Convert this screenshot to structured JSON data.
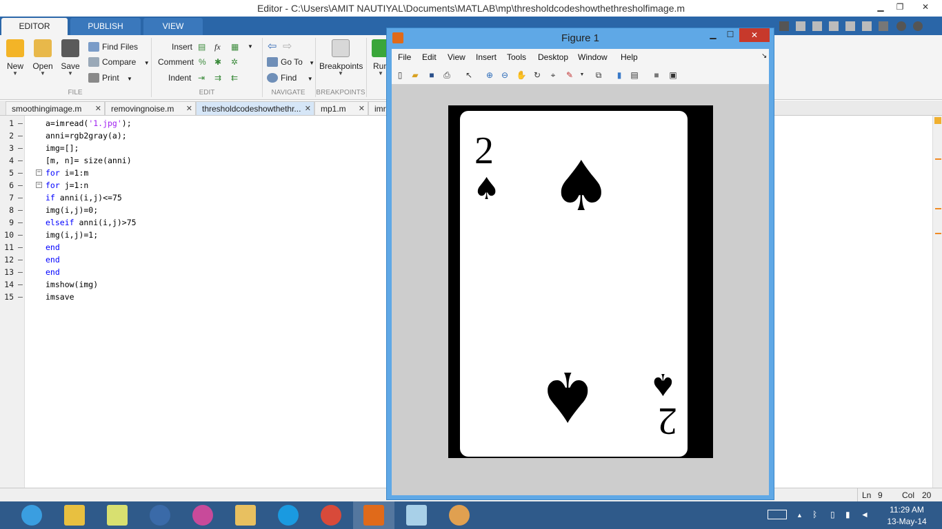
{
  "window": {
    "title": "Editor - C:\\Users\\AMIT NAUTIYAL\\Documents\\MATLAB\\mp\\thresholdcodeshowthethresholfimage.m",
    "min_glyph": "▁",
    "max_glyph": "❐",
    "close_glyph": "✕"
  },
  "ribbon": {
    "tabs": [
      "EDITOR",
      "PUBLISH",
      "VIEW"
    ],
    "file": {
      "new": "New",
      "open": "Open",
      "save": "Save",
      "find_files": "Find Files",
      "compare": "Compare",
      "print": "Print",
      "group": "FILE"
    },
    "edit": {
      "insert": "Insert",
      "comment": "Comment",
      "indent": "Indent",
      "fx": "fx",
      "percent": "%",
      "group": "EDIT"
    },
    "navigate": {
      "goto": "Go To",
      "find": "Find",
      "group": "NAVIGATE"
    },
    "breakpoints": {
      "label": "Breakpoints",
      "group": "BREAKPOINTS"
    },
    "run": {
      "label": "Run"
    },
    "dropdown_glyph": "▼"
  },
  "file_tabs": [
    {
      "name": "smoothingimage.m"
    },
    {
      "name": "removingnoise.m"
    },
    {
      "name": "thresholdcodeshowthethr..."
    },
    {
      "name": "mp1.m"
    },
    {
      "name": "imr"
    }
  ],
  "tab_close_glyph": "✕",
  "code": [
    {
      "n": "1",
      "text": "a=imread('1.jpg');"
    },
    {
      "n": "2",
      "text": "anni=rgb2gray(a);"
    },
    {
      "n": "3",
      "text": "img=[];"
    },
    {
      "n": "4",
      "text": "[m, n]= size(anni)"
    },
    {
      "n": "5",
      "text": "for i=1:m"
    },
    {
      "n": "6",
      "text": "for j=1:n"
    },
    {
      "n": "7",
      "text": "if anni(i,j)<=75"
    },
    {
      "n": "8",
      "text": "img(i,j)=0;"
    },
    {
      "n": "9",
      "text": "elseif anni(i,j)>75"
    },
    {
      "n": "10",
      "text": "img(i,j)=1;"
    },
    {
      "n": "11",
      "text": "end"
    },
    {
      "n": "12",
      "text": "end"
    },
    {
      "n": "13",
      "text": "end"
    },
    {
      "n": "14",
      "text": "imshow(img)"
    },
    {
      "n": "15",
      "text": "imsave"
    }
  ],
  "code_dash": "–",
  "fold_glyph": "−",
  "status": {
    "ln_label": "Ln",
    "ln": "9",
    "col_label": "Col",
    "col": "20"
  },
  "figure": {
    "title": "Figure 1",
    "menu": [
      "File",
      "Edit",
      "View",
      "Insert",
      "Tools",
      "Desktop",
      "Window",
      "Help"
    ],
    "card": {
      "rank": "2",
      "suit": "♠"
    }
  },
  "taskbar": {
    "time": "11:29 AM",
    "date": "13-May-14"
  },
  "colors": {
    "accent": "#2a66a8",
    "keyword": "#0000ff",
    "string": "#a020f0",
    "taskbar": "#2f5a8a"
  }
}
